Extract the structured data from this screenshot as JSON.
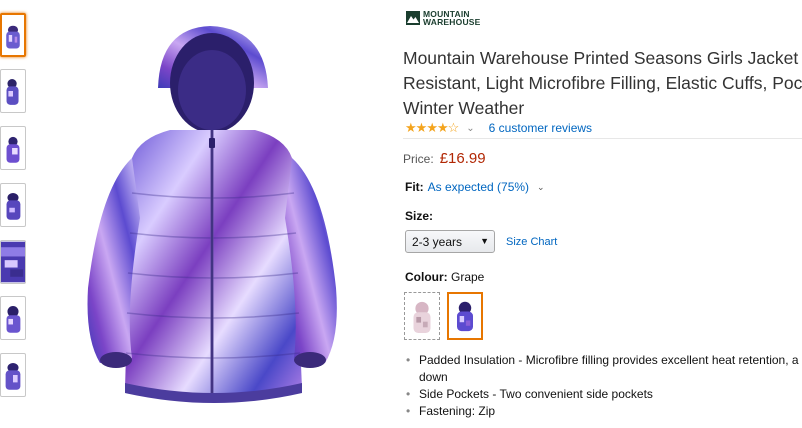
{
  "brand": {
    "logo_line1": "MOUNTAIN",
    "logo_line2": "WAREHOUSE"
  },
  "product": {
    "title_line1": "Mountain Warehouse Printed Seasons Girls Jacket - W",
    "title_line2": "Resistant, Light Microfibre Filling, Elastic Cuffs, Pock",
    "title_line3": "Winter Weather"
  },
  "rating": {
    "stars": 4,
    "max": 5,
    "reviews_link": "6 customer reviews",
    "star_color": "#f4a41d"
  },
  "price": {
    "label": "Price:",
    "value": "£16.99",
    "color": "#b12704"
  },
  "fit": {
    "label": "Fit:",
    "value": "As expected (75%)"
  },
  "size": {
    "label": "Size:",
    "selected": "2-3 years",
    "chart_link": "Size Chart"
  },
  "colour": {
    "label": "Colour:",
    "value": "Grape",
    "swatches": [
      "pink-print",
      "grape"
    ]
  },
  "bullets": [
    {
      "text": "Padded Insulation - Microfibre filling provides excellent heat retention, a",
      "cont": "down"
    },
    {
      "text": "Side Pockets - Two convenient side pockets"
    },
    {
      "text": "Fastening: Zip"
    }
  ],
  "thumbnails": [
    "front",
    "front-small",
    "side",
    "back",
    "detail",
    "hood",
    "front-alt"
  ],
  "accent_color": "#e77600",
  "link_color": "#0066c0"
}
